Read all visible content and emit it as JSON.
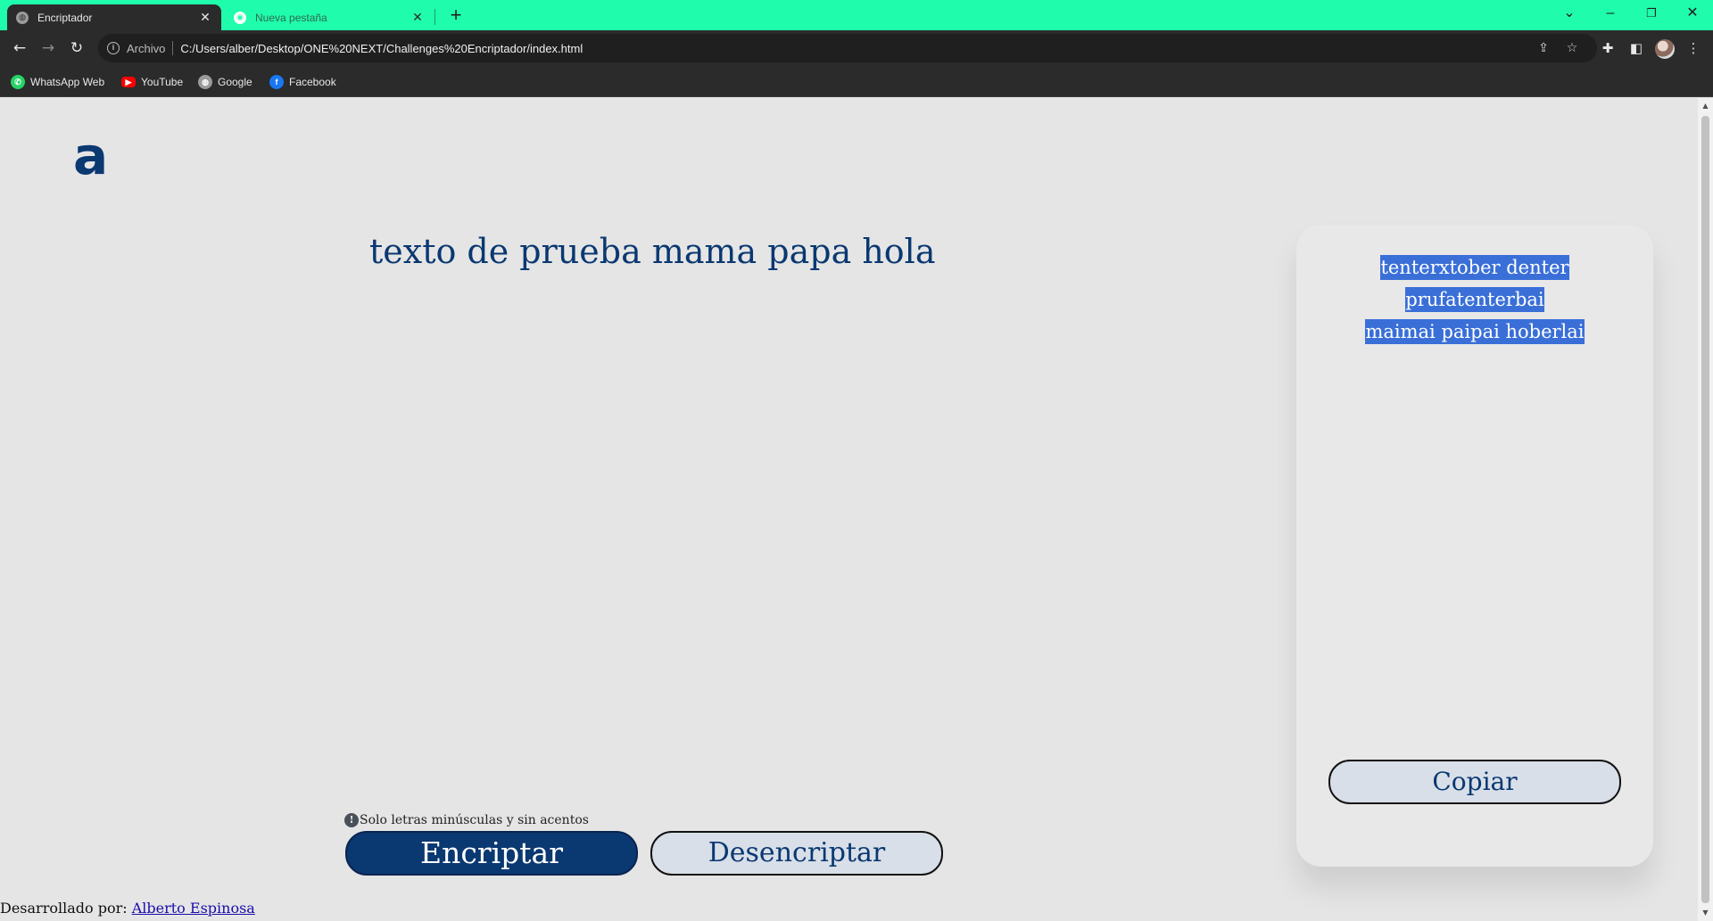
{
  "browser": {
    "tabs": [
      {
        "title": "Encriptador",
        "active": true
      },
      {
        "title": "Nueva pestaña",
        "active": false
      }
    ],
    "new_tab_symbol": "+",
    "window_controls": {
      "menu": "⌄",
      "minimize": "–",
      "restore": "❐",
      "close": "✕"
    },
    "nav": {
      "back": "←",
      "forward": "→",
      "reload": "↻"
    },
    "omnibox": {
      "security_label": "Archivo",
      "url": "C:/Users/alber/Desktop/ONE%20NEXT/Challenges%20Encriptador/index.html"
    },
    "bookmarks": [
      {
        "label": "WhatsApp Web",
        "icon": "whatsapp-icon",
        "color": "#25d366"
      },
      {
        "label": "YouTube",
        "icon": "youtube-icon",
        "color": "#ff0000"
      },
      {
        "label": "Google",
        "icon": "globe-icon",
        "color": "#9a9a9a"
      },
      {
        "label": "Facebook",
        "icon": "facebook-icon",
        "color": "#1877f2"
      }
    ],
    "colors": {
      "tab_strip": "#1ffdac",
      "toolbar": "#2b2b2b"
    }
  },
  "page": {
    "logo_text": "a",
    "input_text": "texto de prueba  mama papa hola",
    "hint_icon": "!",
    "hint_text": "Solo letras minúsculas y sin acentos",
    "encrypt_button": "Encriptar",
    "decrypt_button": "Desencriptar",
    "output_line1": "tenterxtober denter prufatenterbai ",
    "output_line2": "maimai paipai hoberlai",
    "copy_button": "Copiar",
    "footer_prefix": "Desarrollado por: ",
    "footer_link": "Alberto Espinosa",
    "colors": {
      "primary": "#0a3871",
      "background": "#e5e5e5",
      "selection": "#3a6fd8"
    }
  }
}
